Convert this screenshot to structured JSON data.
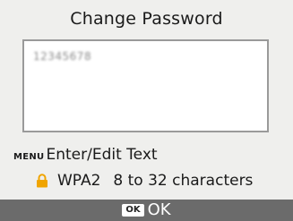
{
  "dialog": {
    "title": "Change Password",
    "password_value": "12345678"
  },
  "hints": {
    "menu_key": "MENU",
    "menu_action": "Enter/Edit Text",
    "security_icon": "lock-icon",
    "security_type": "WPA2",
    "length_rule": "8 to 32 characters"
  },
  "footer": {
    "ok_key": "OK",
    "ok_label": "OK"
  },
  "colors": {
    "background": "#efefed",
    "footer": "#6b6b6b",
    "lock": "#f0a400"
  }
}
